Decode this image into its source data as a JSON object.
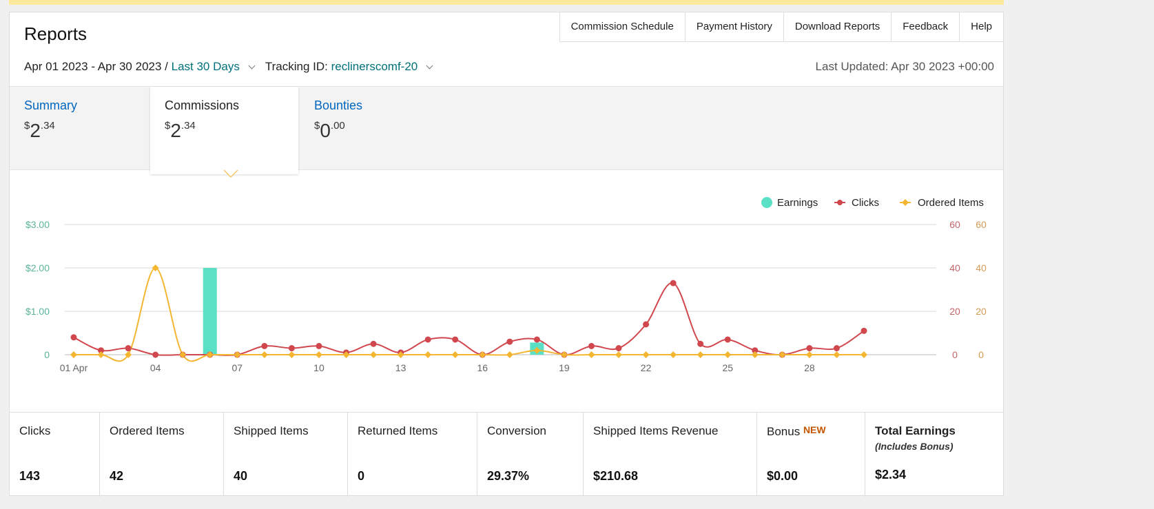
{
  "header": {
    "title": "Reports",
    "nav": [
      "Commission Schedule",
      "Payment History",
      "Download Reports",
      "Feedback",
      "Help"
    ]
  },
  "filters": {
    "date_range": "Apr 01 2023 - Apr 30 2023 /",
    "period": "Last 30 Days",
    "tracking_label": "Tracking ID:",
    "tracking_id": "reclinerscomf-20",
    "last_updated": "Last Updated: Apr 30 2023 +00:00"
  },
  "tabs": [
    {
      "label": "Summary",
      "dollar": "$",
      "whole": "2",
      "cents": ".34"
    },
    {
      "label": "Commissions",
      "dollar": "$",
      "whole": "2",
      "cents": ".34"
    },
    {
      "label": "Bounties",
      "dollar": "$",
      "whole": "0",
      "cents": ".00"
    }
  ],
  "colors": {
    "earnings": "#5ae0c4",
    "clicks": "#d1474e",
    "ordered": "#f4b630",
    "left_axis": "#5bb39a",
    "right_axis1": "#c1656a",
    "right_axis2": "#d39a55"
  },
  "chart_data": {
    "type": "line",
    "legend": [
      "Earnings",
      "Clicks",
      "Ordered Items"
    ],
    "legend_position": "top-right",
    "x": [
      1,
      2,
      3,
      4,
      5,
      6,
      7,
      8,
      9,
      10,
      11,
      12,
      13,
      14,
      15,
      16,
      17,
      18,
      19,
      20,
      21,
      22,
      23,
      24,
      25,
      26,
      27,
      28,
      29,
      30
    ],
    "x_tick_labels": [
      "01 Apr",
      "04",
      "07",
      "10",
      "13",
      "16",
      "19",
      "22",
      "25",
      "28"
    ],
    "x_tick_days": [
      1,
      4,
      7,
      10,
      13,
      16,
      19,
      22,
      25,
      28
    ],
    "left_axis_ticks": [
      "0",
      "$1.00",
      "$2.00",
      "$3.00"
    ],
    "right_axis_ticks": [
      "0",
      "20",
      "40",
      "60"
    ],
    "earnings_ylim": [
      0,
      3
    ],
    "counts_ylim": [
      0,
      60
    ],
    "series": [
      {
        "name": "Earnings",
        "kind": "bar",
        "values": [
          0,
          0,
          0,
          0,
          0,
          2.0,
          0,
          0,
          0,
          0,
          0,
          0,
          0,
          0,
          0,
          0,
          0,
          0.28,
          0,
          0,
          0,
          0,
          0,
          0,
          0,
          0,
          0,
          0,
          0,
          0
        ]
      },
      {
        "name": "Clicks",
        "kind": "line",
        "values": [
          8,
          2,
          3,
          0,
          0,
          0,
          0,
          4,
          3,
          4,
          1,
          5,
          1,
          7,
          7,
          0,
          6,
          7,
          0,
          4,
          3,
          14,
          33,
          5,
          7,
          2,
          0,
          3,
          3,
          11
        ]
      },
      {
        "name": "Ordered Items",
        "kind": "line",
        "values": [
          0,
          0,
          0,
          40,
          0,
          0,
          0,
          0,
          0,
          0,
          0,
          0,
          0,
          0,
          0,
          0,
          0,
          2,
          0,
          0,
          0,
          0,
          0,
          0,
          0,
          0,
          0,
          0,
          0,
          0
        ]
      }
    ],
    "grid": true
  },
  "stats": [
    {
      "label": "Clicks",
      "value": "143"
    },
    {
      "label": "Ordered Items",
      "value": "42"
    },
    {
      "label": "Shipped Items",
      "value": "40"
    },
    {
      "label": "Returned Items",
      "value": "0"
    },
    {
      "label": "Conversion",
      "value": "29.37%"
    },
    {
      "label": "Shipped Items Revenue",
      "value": "$210.68"
    },
    {
      "label": "Bonus",
      "badge": "NEW",
      "value": "$0.00"
    },
    {
      "label": "Total Earnings",
      "sub": "(Includes Bonus)",
      "value": "$2.34"
    }
  ]
}
